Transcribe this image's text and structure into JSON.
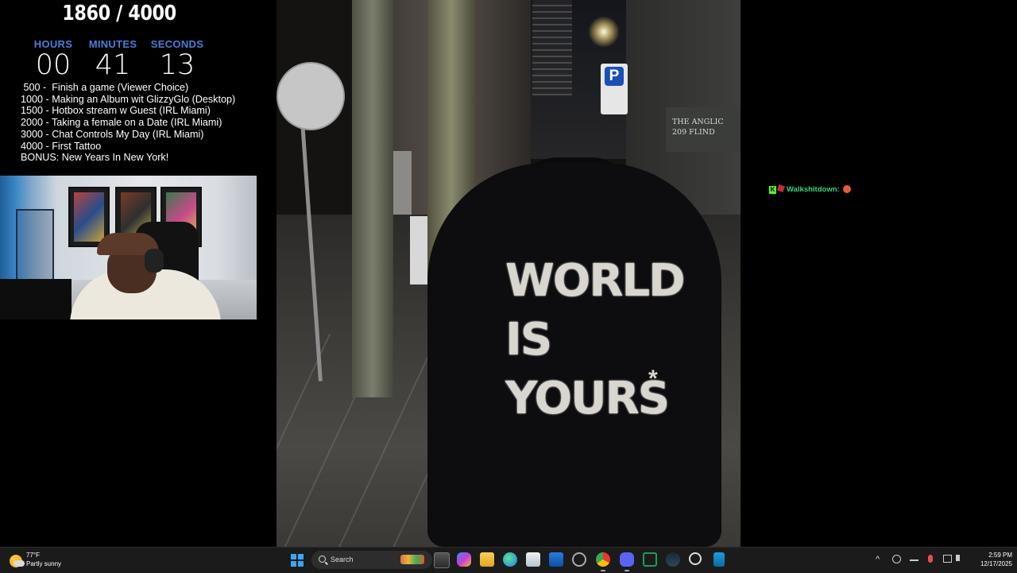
{
  "overlay": {
    "goal_counter": "1860 / 4000",
    "timer": {
      "hours_label": "HOURS",
      "hours": "00",
      "minutes_label": "MINUTES",
      "minutes": "41",
      "seconds_label": "SECONDS",
      "seconds": "13"
    },
    "goals": [
      " 500 -  Finish a game (Viewer Choice)",
      "1000 - Making an Album wit GlizzyGlo (Desktop)",
      "1500 - Hotbox stream w Guest (IRL Miami)",
      "2000 - Taking a female on a Date (IRL Miami)",
      "3000 - Chat Controls My Day (IRL Miami)",
      "4000 - First Tattoo",
      "BONUS: New Years In New York!"
    ]
  },
  "photo": {
    "hoodie_text": "WORLD\nIS\nYOURS",
    "hoodie_asterisk": "*",
    "parking_sign": "P",
    "wall_plaque": "THE ANGLIC\n209 FLIND"
  },
  "chat": {
    "badge": "K",
    "username": "Walkshitdown:"
  },
  "taskbar": {
    "weather_temp": "77°F",
    "weather_desc": "Partly sunny",
    "search_label": "Search",
    "clock_time": "2:59 PM",
    "clock_date": "12/17/2025",
    "tray_chevron": "^"
  }
}
